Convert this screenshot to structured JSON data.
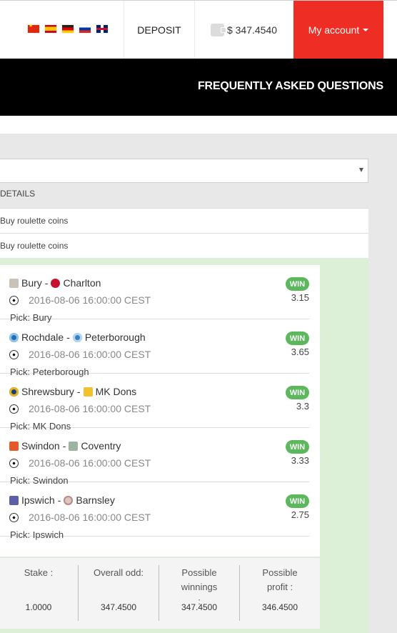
{
  "header": {
    "flags": [
      {
        "name": "flag-china",
        "lang": "Chinese"
      },
      {
        "name": "flag-spain",
        "lang": "Spanish"
      },
      {
        "name": "flag-germany",
        "lang": "German"
      },
      {
        "name": "flag-russia",
        "lang": "Russian"
      },
      {
        "name": "flag-uk",
        "lang": "English"
      }
    ],
    "deposit_label": "DEPOSIT",
    "balance": "$ 347.4540",
    "account_label": "My account",
    "accent_color": "#ee2e24"
  },
  "banner": {
    "title": "FREQUENTLY ASKED QUESTIONS"
  },
  "filter": {
    "selected": ""
  },
  "details": {
    "label": "DETAILS",
    "transactions": [
      {
        "label": "Buy roulette coins"
      },
      {
        "label": "Buy roulette coins"
      }
    ]
  },
  "bets": [
    {
      "home": "Bury",
      "away": "Charlton",
      "date": "2016-08-06 16:00:00 CEST",
      "pick": "Pick: Bury",
      "status": "WIN",
      "odd": "3.15"
    },
    {
      "home": "Rochdale",
      "away": "Peterborough",
      "date": "2016-08-06 16:00:00 CEST",
      "pick": "Pick: Peterborough",
      "status": "WIN",
      "odd": "3.65"
    },
    {
      "home": "Shrewsbury",
      "away": "MK Dons",
      "date": "2016-08-06 16:00:00 CEST",
      "pick": "Pick: MK Dons",
      "status": "WIN",
      "odd": "3.3"
    },
    {
      "home": "Swindon",
      "away": "Coventry",
      "date": "2016-08-06 16:00:00 CEST",
      "pick": "Pick: Swindon",
      "status": "WIN",
      "odd": "3.33"
    },
    {
      "home": "Ipswich",
      "away": "Barnsley",
      "date": "2016-08-06 16:00:00 CEST",
      "pick": "Pick: Ipswich",
      "status": "WIN",
      "odd": "2.75"
    }
  ],
  "separator": "-",
  "summary": {
    "stake_label": "Stake :",
    "stake_value": "1.0000",
    "odd_label": "Overall odd:",
    "odd_value": "347.4500",
    "winnings_label": "Possible winnings :",
    "winnings_value": "347.4500",
    "profit_label": "Possible profit :",
    "profit_value": "346.4500"
  },
  "colors": {
    "win_badge": "#5cb85c",
    "panel_green": "#dcf0d8"
  }
}
